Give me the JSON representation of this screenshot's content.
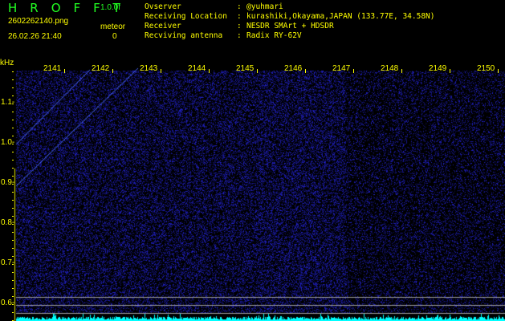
{
  "header": {
    "title": "HROFFT",
    "version": "1.0.0f",
    "filename": "2602262140.png",
    "datetime": "26.02.26 21:40",
    "meteor_label": "meteor",
    "meteor_count": "0"
  },
  "info": {
    "labels": [
      "Ovserver",
      "Receiving Location",
      "Receiver",
      "Recviving antenna"
    ],
    "values": [
      "@yuhmari",
      "kurashiki,Okayama,JAPAN (133.77E, 34.58N)",
      "NESDR SMArt + HDSDR",
      "Radix RY-62V"
    ]
  },
  "chart_data": {
    "type": "heatmap",
    "ylabel": "kHz",
    "x_ticks": [
      "2141",
      "2142",
      "2143",
      "2144",
      "2145",
      "2146",
      "2147",
      "2148",
      "2149",
      "2150"
    ],
    "y_ticks": [
      "1.1",
      "1.0",
      "0.9",
      "0.8",
      "0.7",
      "0.6"
    ],
    "ylim": [
      0.57,
      1.2
    ],
    "colors": {
      "noise": "#2020c0",
      "lines": "#a0a0a0",
      "spectrum": "#00ffff",
      "axis": "#ffff00"
    }
  }
}
